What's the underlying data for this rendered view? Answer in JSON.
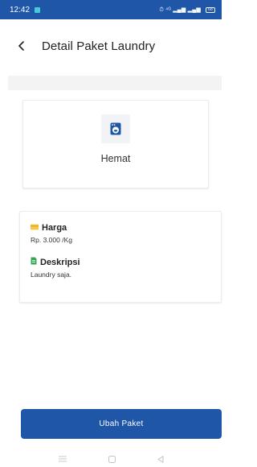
{
  "status_bar": {
    "time": "12:42",
    "indicators": "⏱ ⁴ᴳ ▂▄▆ ▂▄▆",
    "battery": "68",
    "background": "#1f56a8"
  },
  "header": {
    "title": "Detail Paket Laundry"
  },
  "package": {
    "name": "Hemat",
    "icon": "washing-machine-icon",
    "icon_color": "#1f56a8"
  },
  "details": {
    "price_label": "Harga",
    "price_value": "Rp. 3.000 /Kg",
    "price_icon": "money-icon",
    "price_icon_color": "#f2c94c",
    "description_label": "Deskripsi",
    "description_value": "Laundry saja.",
    "description_icon": "document-icon",
    "description_icon_color": "#34a853"
  },
  "actions": {
    "edit_label": "Ubah Paket",
    "accent": "#1f56a8"
  },
  "nav": {
    "icons": [
      "menu-icon",
      "home-square-icon",
      "back-triangle-icon"
    ]
  }
}
